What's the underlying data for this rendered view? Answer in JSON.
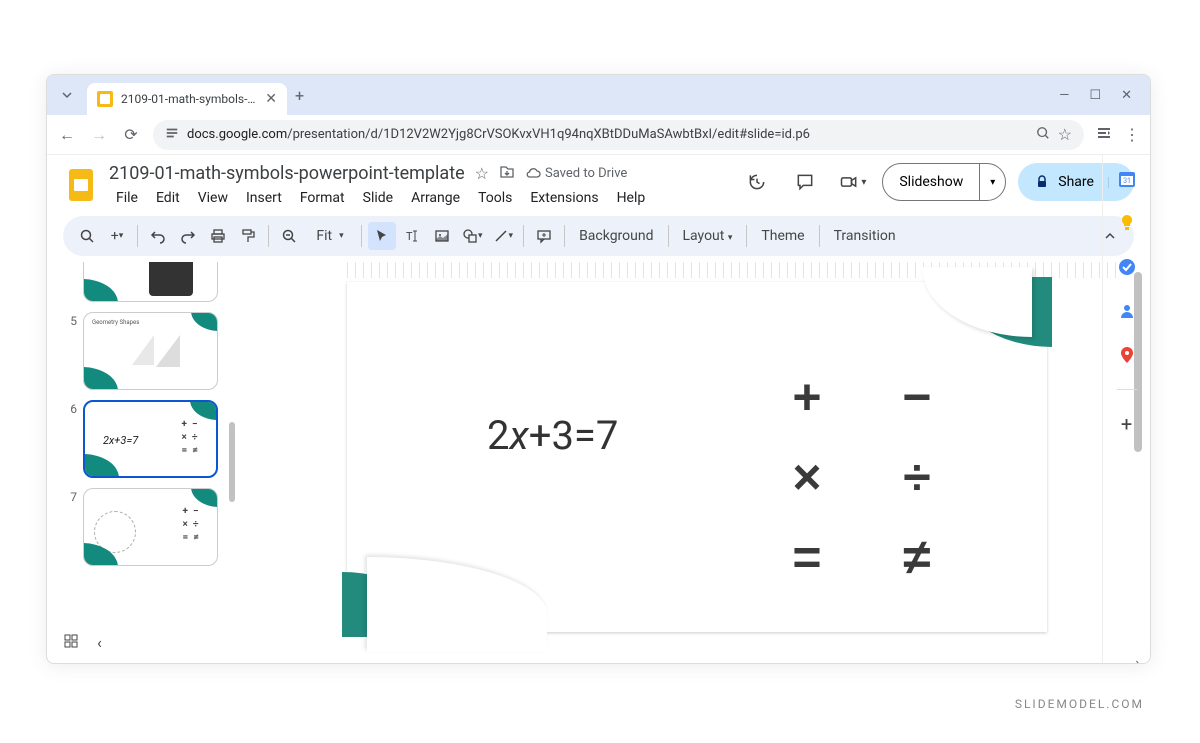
{
  "browser": {
    "tab_title": "2109-01-math-symbols-powerp",
    "url_prefix": "docs.google.com",
    "url_path": "/presentation/d/1D12V2W2Yjg8CrVSOKvxVH1q94nqXBtDDuMaSAwbtBxI/edit#slide=id.p6"
  },
  "doc": {
    "title": "2109-01-math-symbols-powerpoint-template",
    "save_status": "Saved to Drive"
  },
  "menu": [
    "File",
    "Edit",
    "View",
    "Insert",
    "Format",
    "Slide",
    "Arrange",
    "Tools",
    "Extensions",
    "Help"
  ],
  "header_buttons": {
    "slideshow": "Slideshow",
    "share": "Share"
  },
  "toolbar": {
    "zoom": "Fit",
    "background": "Background",
    "layout": "Layout",
    "theme": "Theme",
    "transition": "Transition"
  },
  "thumbs": [
    {
      "num": "",
      "title": ""
    },
    {
      "num": "5",
      "title": "Geometry Shapes"
    },
    {
      "num": "6",
      "equation": "2x+3=7"
    },
    {
      "num": "7",
      "title": ""
    }
  ],
  "slide": {
    "equation": {
      "a": "2",
      "var": "x",
      "b": "+3=7"
    },
    "symbols": [
      "+",
      "−",
      "×",
      "÷",
      "=",
      "≠"
    ]
  },
  "watermark": "SLIDEMODEL.COM"
}
